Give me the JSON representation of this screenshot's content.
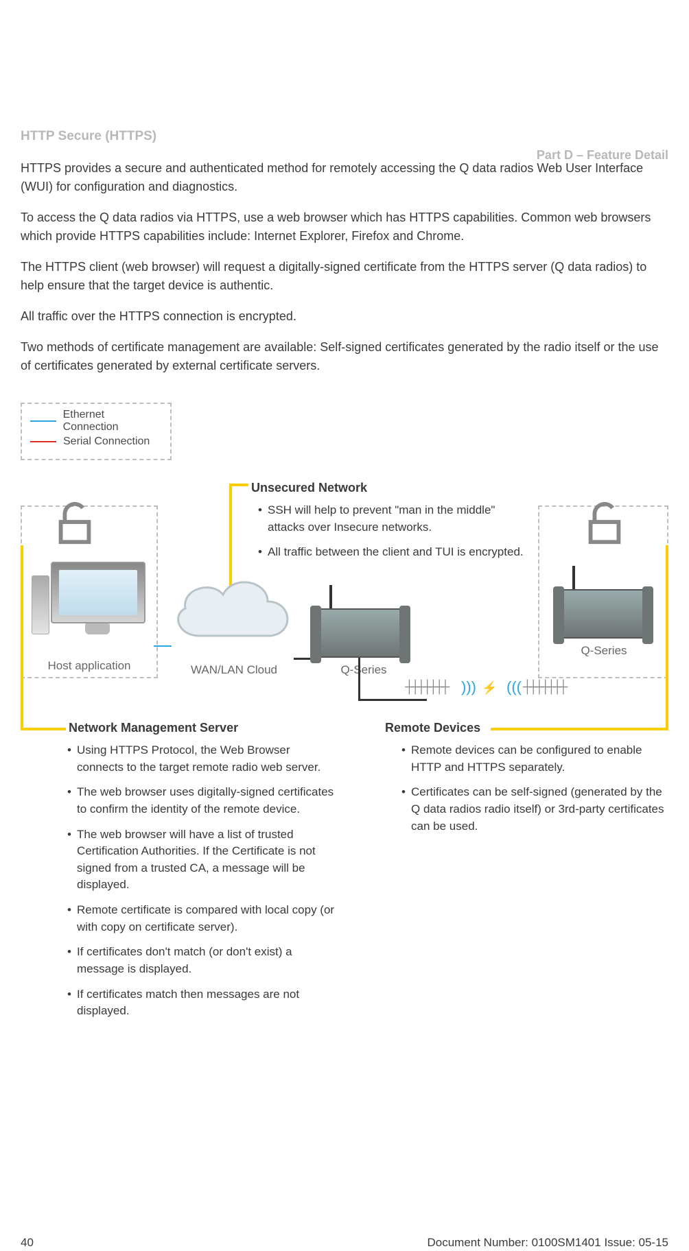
{
  "header": {
    "right": "Part D – Feature Detail"
  },
  "section_title": "HTTP Secure (HTTPS)",
  "paragraphs": [
    "HTTPS provides a secure and authenticated method for remotely accessing the Q data radios Web User Interface (WUI) for configuration and diagnostics.",
    "To access the Q data radios via HTTPS, use a web browser which has HTTPS capabilities. Common web browsers which provide HTTPS capabilities include: Internet Explorer, Firefox and Chrome.",
    "The HTTPS client (web browser) will request a digitally-signed certificate from the HTTPS server (Q data radios) to help ensure that the target device is authentic.",
    "All traffic over the HTTPS connection is encrypted.",
    "Two methods of certificate management are available: Self-signed certificates generated by the radio itself or the use of certificates generated by external certificate servers."
  ],
  "legend": {
    "ethernet": "Ethernet Connection",
    "serial": "Serial Connection"
  },
  "diagram_labels": {
    "host": "Host application",
    "wan": "WAN/LAN Cloud",
    "q1": "Q-Series",
    "q2": "Q-Series"
  },
  "callouts": {
    "unsecured": {
      "title": "Unsecured Network",
      "items": [
        "SSH will help to prevent \"man in the middle\" attacks over Insecure networks.",
        "All traffic between the client and TUI is encrypted."
      ]
    },
    "nms": {
      "title": "Network Management Server",
      "items": [
        "Using HTTPS Protocol, the Web Browser connects to the target remote radio web server.",
        "The web browser uses digitally-signed certificates to confirm the identity of the remote device.",
        "The web browser will have a list of trusted Certification Authorities. If the Certificate is not signed from a trusted CA, a message will be displayed.",
        "Remote certificate is compared with local copy (or with copy on certificate server).",
        "If certificates don't match (or don't exist) a message is displayed.",
        "If certificates match then messages are not displayed."
      ]
    },
    "remote": {
      "title": "Remote Devices",
      "items": [
        "Remote devices can be configured to enable HTTP and HTTPS separately.",
        "Certificates can be self-signed (generated by the  Q data radios radio itself) or 3rd-party certificates can be used."
      ]
    }
  },
  "footer": {
    "page": "40",
    "doc": "Document Number: 0100SM1401    Issue: 05-15"
  }
}
